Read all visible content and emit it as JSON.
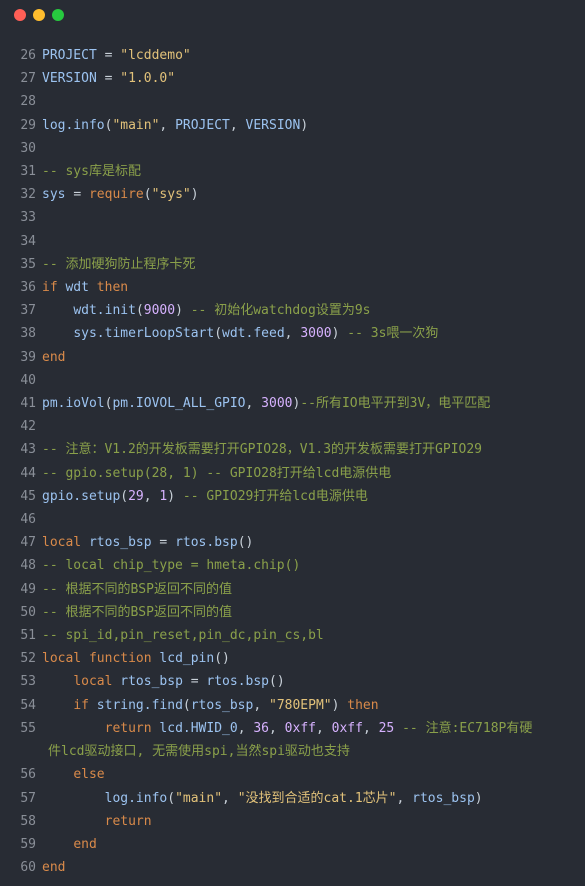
{
  "window": {
    "controls": [
      "close-button",
      "minimize-button",
      "maximize-button"
    ],
    "colors": {
      "background": "#282c34",
      "red": "#ff5f56",
      "yellow": "#ffbd2e",
      "green": "#27c93f"
    }
  },
  "editor": {
    "lines": [
      {
        "n": "26",
        "text": "PROJECT = \"lcddemo\""
      },
      {
        "n": "27",
        "text": "VERSION = \"1.0.0\""
      },
      {
        "n": "28",
        "text": ""
      },
      {
        "n": "29",
        "text": "log.info(\"main\", PROJECT, VERSION)"
      },
      {
        "n": "30",
        "text": ""
      },
      {
        "n": "31",
        "text": "-- sys库是标配"
      },
      {
        "n": "32",
        "text": "sys = require(\"sys\")"
      },
      {
        "n": "33",
        "text": ""
      },
      {
        "n": "34",
        "text": ""
      },
      {
        "n": "35",
        "text": "-- 添加硬狗防止程序卡死"
      },
      {
        "n": "36",
        "text": "if wdt then"
      },
      {
        "n": "37",
        "text": "    wdt.init(9000) -- 初始化watchdog设置为9s"
      },
      {
        "n": "38",
        "text": "    sys.timerLoopStart(wdt.feed, 3000) -- 3s喂一次狗"
      },
      {
        "n": "39",
        "text": "end"
      },
      {
        "n": "40",
        "text": ""
      },
      {
        "n": "41",
        "text": "pm.ioVol(pm.IOVOL_ALL_GPIO, 3000)--所有IO电平开到3V，电平匹配"
      },
      {
        "n": "42",
        "text": ""
      },
      {
        "n": "43",
        "text": "-- 注意：V1.2的开发板需要打开GPIO28，V1.3的开发板需要打开GPIO29"
      },
      {
        "n": "44",
        "text": "-- gpio.setup(28, 1) -- GPIO28打开给lcd电源供电"
      },
      {
        "n": "45",
        "text": "gpio.setup(29, 1) -- GPIO29打开给lcd电源供电"
      },
      {
        "n": "46",
        "text": ""
      },
      {
        "n": "47",
        "text": "local rtos_bsp = rtos.bsp()"
      },
      {
        "n": "48",
        "text": "-- local chip_type = hmeta.chip()"
      },
      {
        "n": "49",
        "text": "-- 根据不同的BSP返回不同的值"
      },
      {
        "n": "50",
        "text": "-- 根据不同的BSP返回不同的值"
      },
      {
        "n": "51",
        "text": "-- spi_id,pin_reset,pin_dc,pin_cs,bl"
      },
      {
        "n": "52",
        "text": "local function lcd_pin()"
      },
      {
        "n": "53",
        "text": "    local rtos_bsp = rtos.bsp()"
      },
      {
        "n": "54",
        "text": "    if string.find(rtos_bsp, \"780EPM\") then"
      },
      {
        "n": "55",
        "text": "        return lcd.HWID_0, 36, 0xff, 0xff, 25 -- 注意:EC718P有硬",
        "wrap": "件lcd驱动接口, 无需使用spi,当然spi驱动也支持"
      },
      {
        "n": "56",
        "text": "    else"
      },
      {
        "n": "57",
        "text": "        log.info(\"main\", \"没找到合适的cat.1芯片\", rtos_bsp)"
      },
      {
        "n": "58",
        "text": "        return"
      },
      {
        "n": "59",
        "text": "    end"
      },
      {
        "n": "60",
        "text": "end"
      }
    ]
  }
}
